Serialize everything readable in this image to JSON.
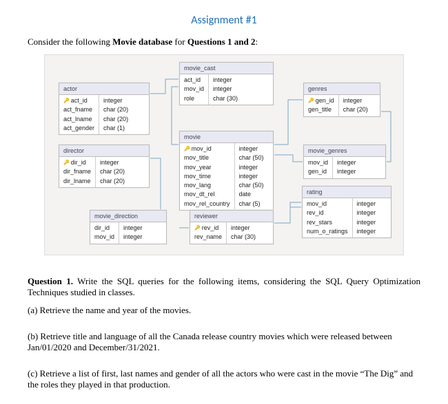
{
  "title": "Assignment #1",
  "intro_prefix": "Consider the following ",
  "intro_bold1": "Movie database",
  "intro_mid": " for ",
  "intro_bold2": "Questions 1 and 2",
  "intro_suffix": ":",
  "tables": {
    "actor": {
      "name": "actor",
      "cols": [
        {
          "n": "act_id",
          "t": "integer",
          "pk": true
        },
        {
          "n": "act_fname",
          "t": "char (20)"
        },
        {
          "n": "act_lname",
          "t": "char (20)"
        },
        {
          "n": "act_gender",
          "t": "char (1)"
        }
      ]
    },
    "movie_cast": {
      "name": "movie_cast",
      "cols": [
        {
          "n": "act_id",
          "t": "integer"
        },
        {
          "n": "mov_id",
          "t": "integer"
        },
        {
          "n": "role",
          "t": "char (30)"
        }
      ]
    },
    "genres": {
      "name": "genres",
      "cols": [
        {
          "n": "gen_id",
          "t": "integer",
          "pk": true
        },
        {
          "n": "gen_title",
          "t": "char (20)"
        }
      ]
    },
    "director": {
      "name": "director",
      "cols": [
        {
          "n": "dir_id",
          "t": "integer",
          "pk": true
        },
        {
          "n": "dir_fname",
          "t": "char (20)"
        },
        {
          "n": "dir_lname",
          "t": "char (20)"
        }
      ]
    },
    "movie": {
      "name": "movie",
      "cols": [
        {
          "n": "mov_id",
          "t": "integer",
          "pk": true
        },
        {
          "n": "mov_title",
          "t": "char (50)"
        },
        {
          "n": "mov_year",
          "t": "integer"
        },
        {
          "n": "mov_time",
          "t": "integer"
        },
        {
          "n": "mov_lang",
          "t": "char (50)"
        },
        {
          "n": "mov_dt_rel",
          "t": "date"
        },
        {
          "n": "mov_rel_country",
          "t": "char (5)"
        }
      ]
    },
    "movie_genres": {
      "name": "movie_genres",
      "cols": [
        {
          "n": "mov_id",
          "t": "integer"
        },
        {
          "n": "gen_id",
          "t": "integer"
        }
      ]
    },
    "movie_direction": {
      "name": "movie_direction",
      "cols": [
        {
          "n": "dir_id",
          "t": "integer"
        },
        {
          "n": "mov_id",
          "t": "integer"
        }
      ]
    },
    "reviewer": {
      "name": "reviewer",
      "cols": [
        {
          "n": "rev_id",
          "t": "integer",
          "pk": true
        },
        {
          "n": "rev_name",
          "t": "char (30)"
        }
      ]
    },
    "rating": {
      "name": "rating",
      "cols": [
        {
          "n": "mov_id",
          "t": "integer"
        },
        {
          "n": "rev_id",
          "t": "integer"
        },
        {
          "n": "rev_stars",
          "t": "integer"
        },
        {
          "n": "num_o_ratings",
          "t": "integer"
        }
      ]
    }
  },
  "q1_label": "Question 1.",
  "q1_text": " Write the SQL queries for the following items, considering the SQL Query Optimization Techniques studied in classes.",
  "q1a": "(a) Retrieve the name and year of the movies.",
  "q1b": "(b) Retrieve title and language of all the Canada release country movies which were released between Jan/01/2020 and December/31/2021.",
  "q1c": "(c) Retrieve a list of first, last names and gender of all the actors who were cast in the movie “The Dig” and the roles they played in that production."
}
